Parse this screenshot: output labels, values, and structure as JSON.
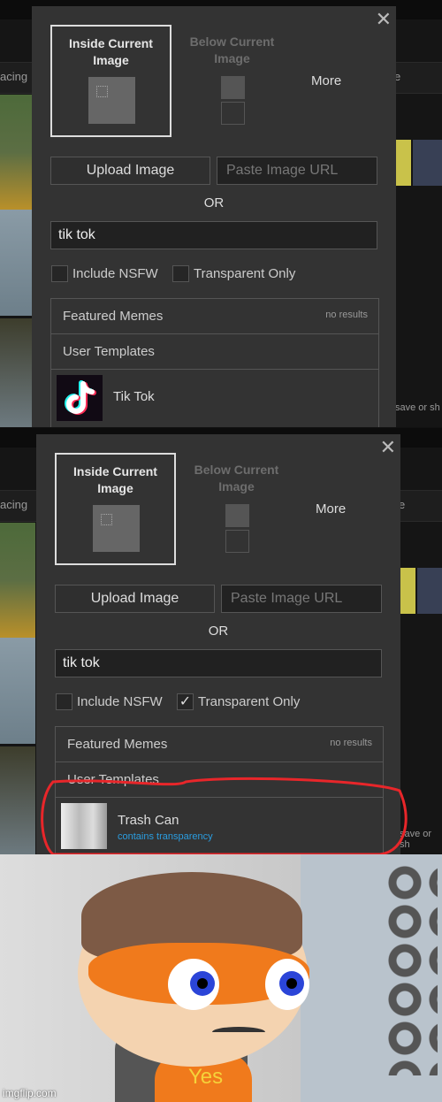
{
  "panels": [
    {
      "dialog": {
        "close_icon": "close-icon",
        "option_inside": "Inside Current Image",
        "option_below": "Below Current Image",
        "option_more": "More",
        "upload_label": "Upload Image",
        "url_placeholder": "Paste Image URL",
        "or_label": "OR",
        "search_value": "tik tok",
        "include_nsfw": {
          "label": "Include NSFW",
          "checked": false
        },
        "transparent_only": {
          "label": "Transparent Only",
          "checked": false
        },
        "featured_memes": "Featured Memes",
        "featured_status": "no results",
        "user_templates": "User Templates",
        "result": {
          "name": "Tik Tok",
          "icon": "tiktok-logo"
        }
      }
    },
    {
      "dialog": {
        "close_icon": "close-icon",
        "option_inside": "Inside Current Image",
        "option_below": "Below Current Image",
        "option_more": "More",
        "upload_label": "Upload Image",
        "url_placeholder": "Paste Image URL",
        "or_label": "OR",
        "search_value": "tik tok",
        "include_nsfw": {
          "label": "Include NSFW",
          "checked": false
        },
        "transparent_only": {
          "label": "Transparent Only",
          "checked": true,
          "mark": "✓"
        },
        "featured_memes": "Featured Memes",
        "featured_status": "no results",
        "user_templates": "User Templates",
        "result": {
          "name": "Trash Can",
          "subtitle": "contains transparency",
          "icon": "trash-can-thumbnail"
        },
        "highlight_color": "#e8262a"
      }
    }
  ],
  "background": {
    "left_text": "acing",
    "right_text": "save or sh",
    "right_text2": "e"
  },
  "meme": {
    "caption": "Yes",
    "watermark": "imgflip.com",
    "accent": "#f07a1c"
  }
}
